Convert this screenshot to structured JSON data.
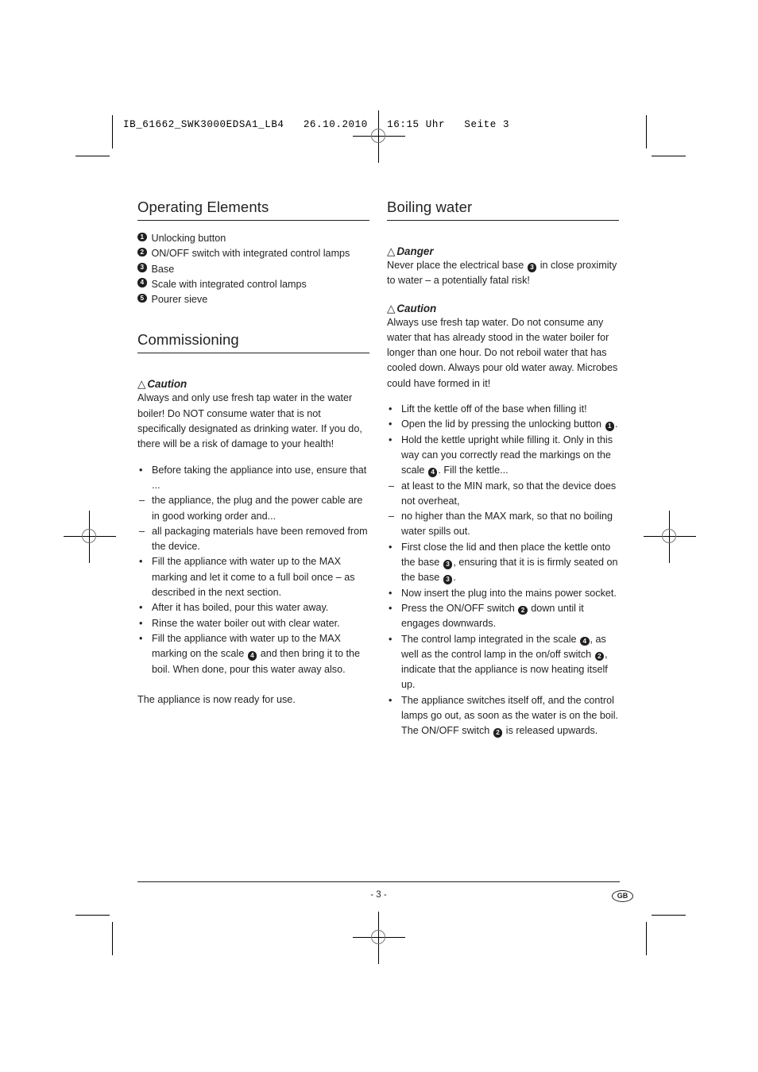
{
  "header": {
    "meta_line": "IB_61662_SWK3000EDSA1_LB4   26.10.2010   16:15 Uhr   Seite 3"
  },
  "footer": {
    "page_number": "- 3 -",
    "language_badge": "GB"
  },
  "left_column": {
    "section1": {
      "title": "Operating Elements",
      "items": [
        {
          "num": "1",
          "label": "Unlocking button"
        },
        {
          "num": "2",
          "label": "ON/OFF switch with integrated control lamps"
        },
        {
          "num": "3",
          "label": "Base"
        },
        {
          "num": "4",
          "label": "Scale with integrated control lamps"
        },
        {
          "num": "5",
          "label": "Pourer sieve"
        }
      ]
    },
    "section2": {
      "title": "Commissioning",
      "caution_label": "Caution",
      "caution_icon": "warning-triangle",
      "caution_text": "Always and only use fresh tap water in the water boiler! Do NOT consume water that is not specifically designated as drinking water. If you do, there will be a risk of damage to your health!",
      "bullets": [
        {
          "lead": "•",
          "text_before": "Before taking the appliance into use, ensure that ...",
          "ref": "",
          "text_after": ""
        },
        {
          "lead": "–",
          "text_before": "the appliance, the plug and the power cable are in good working order and...",
          "ref": "",
          "text_after": ""
        },
        {
          "lead": "–",
          "text_before": "all packaging materials have been removed from the device.",
          "ref": "",
          "text_after": ""
        },
        {
          "lead": "•",
          "text_before": "Fill the appliance with water up to the MAX marking and let it come to a full boil once – as described in the next section.",
          "ref": "",
          "text_after": ""
        },
        {
          "lead": "•",
          "text_before": "After it has boiled, pour this water away.",
          "ref": "",
          "text_after": ""
        },
        {
          "lead": "•",
          "text_before": "Rinse the water boiler out with clear water.",
          "ref": "",
          "text_after": ""
        },
        {
          "lead": "•",
          "text_before": "Fill the appliance with water up to the MAX marking on the scale ",
          "ref": "4",
          "text_after": " and then bring it to the boil. When done, pour this water away also."
        }
      ],
      "closing": "The appliance is now ready for use."
    }
  },
  "right_column": {
    "section1": {
      "title": "Boiling water",
      "danger_label": "Danger",
      "danger_icon": "warning-triangle",
      "danger_text_before": "Never place the electrical base ",
      "danger_ref": "3",
      "danger_text_after": " in close proximity to water – a potentially fatal risk!",
      "caution_label": "Caution",
      "caution_icon": "warning-triangle",
      "caution_text": "Always use fresh tap water. Do not consume any water that has already stood in the water boiler for longer than one hour. Do not reboil water that has cooled down. Always pour old water away. Microbes could have formed in it!",
      "bullets": [
        {
          "lead": "•",
          "parts": [
            {
              "t": "Lift the kettle off of the base when filling it!"
            }
          ]
        },
        {
          "lead": "•",
          "parts": [
            {
              "t": "Open the lid by pressing the unlocking button "
            },
            {
              "r": "1"
            },
            {
              "t": "."
            }
          ]
        },
        {
          "lead": "•",
          "parts": [
            {
              "t": "Hold the kettle upright while filling it. Only in this way can you correctly read the markings on the scale "
            },
            {
              "r": "4"
            },
            {
              "t": ". Fill the kettle..."
            }
          ]
        },
        {
          "lead": "–",
          "parts": [
            {
              "t": "at least to the MIN mark, so that the device does not overheat,"
            }
          ]
        },
        {
          "lead": "–",
          "parts": [
            {
              "t": "no higher than the MAX mark, so that no boiling water spills out."
            }
          ]
        },
        {
          "lead": "•",
          "parts": [
            {
              "t": "First close the lid and then place the kettle onto the base "
            },
            {
              "r": "3"
            },
            {
              "t": ", ensuring that it is is firmly seated on the base "
            },
            {
              "r": "3"
            },
            {
              "t": "."
            }
          ]
        },
        {
          "lead": "•",
          "parts": [
            {
              "t": "Now insert the plug into the mains power socket."
            }
          ]
        },
        {
          "lead": "•",
          "parts": [
            {
              "t": "Press the ON/OFF switch "
            },
            {
              "r": "2"
            },
            {
              "t": " down until it engages downwards."
            }
          ]
        },
        {
          "lead": "•",
          "parts": [
            {
              "t": "The control lamp integrated in the scale "
            },
            {
              "r": "4"
            },
            {
              "t": ", as well as the control lamp in the on/off switch "
            },
            {
              "r": "2"
            },
            {
              "t": ", indicate that the appliance is now heating itself up."
            }
          ]
        },
        {
          "lead": "•",
          "parts": [
            {
              "t": "The appliance switches itself off, and the control lamps go out, as soon as the water is on the boil. The ON/OFF switch "
            },
            {
              "r": "2"
            },
            {
              "t": " is released upwards."
            }
          ]
        }
      ]
    }
  },
  "print_marks": {
    "registration_icon": "registration-crosshair",
    "crop_icon": "crop-mark"
  }
}
